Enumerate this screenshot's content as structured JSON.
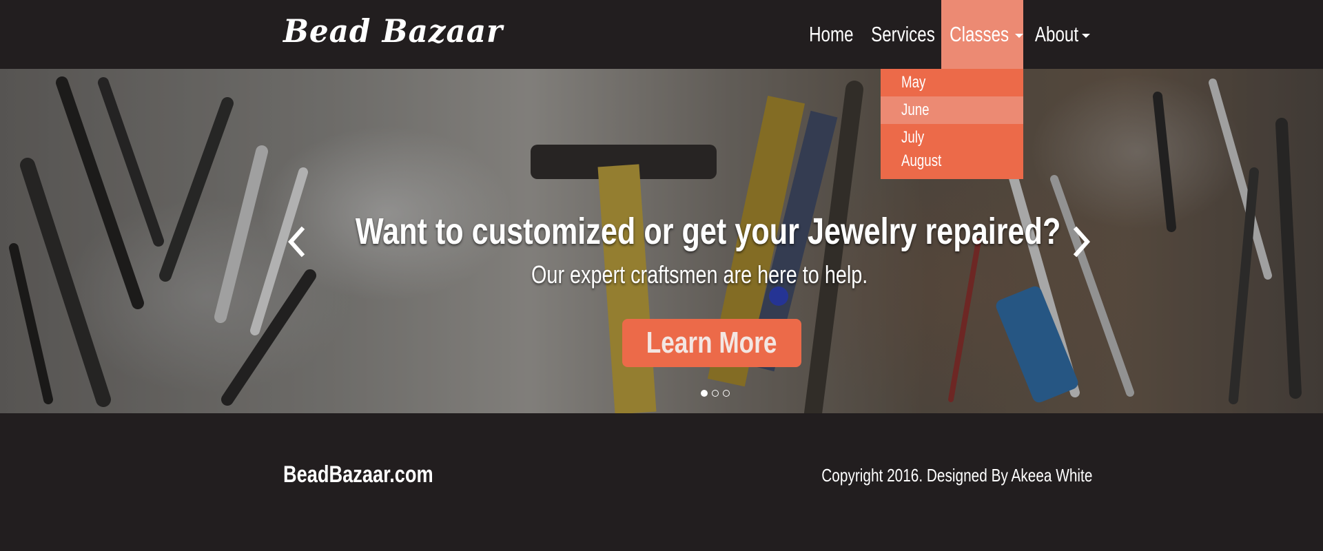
{
  "header": {
    "brand": "Bead Bazaar",
    "nav": {
      "home": "Home",
      "services": "Services",
      "classes": "Classes",
      "about": "About"
    },
    "classes_dropdown": [
      "May",
      "June",
      "July",
      "August"
    ]
  },
  "hero": {
    "title": "Want to customized or get your Jewelry repaired?",
    "subtitle": "Our expert craftsmen are here to help.",
    "cta_label": "Learn More",
    "slide_count": 3,
    "active_slide": 1
  },
  "footer": {
    "brand": "BeadBazaar.com",
    "copyright": "Copyright 2016. Designed By Akeea White"
  },
  "colors": {
    "background": "#221e1f",
    "accent": "#ec6a49",
    "accent_light": "#ec8a73"
  }
}
